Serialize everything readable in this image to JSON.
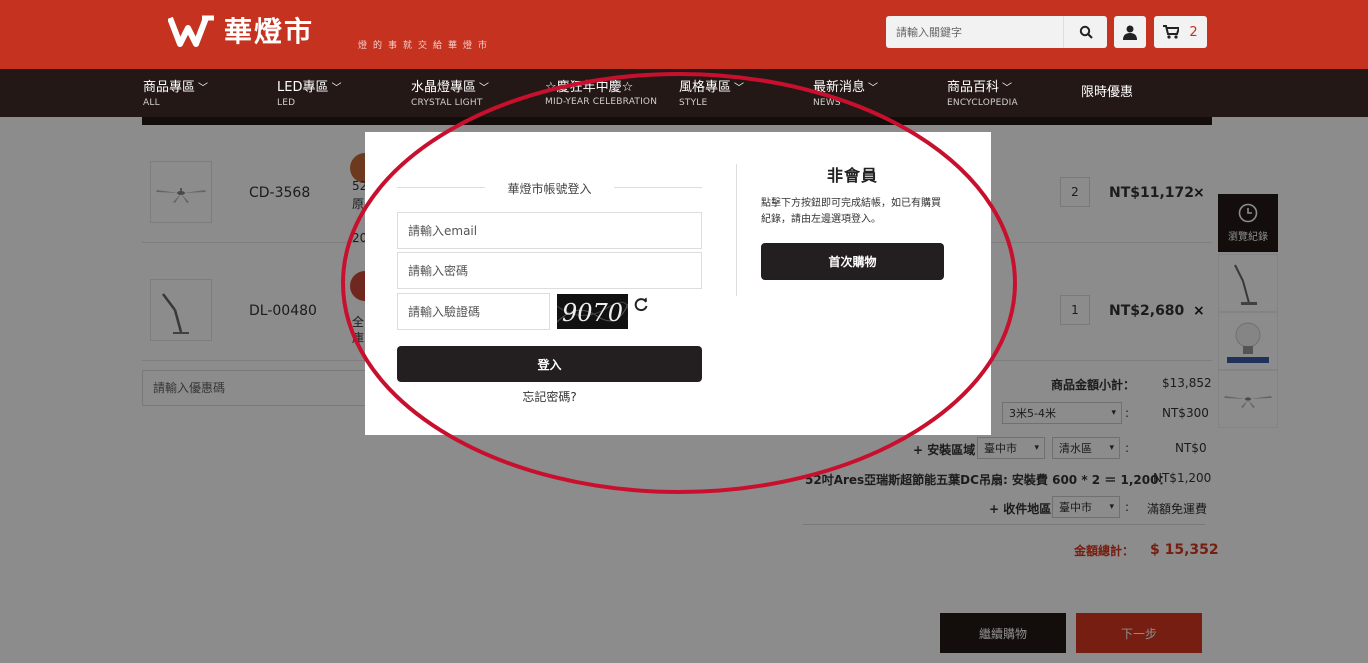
{
  "header": {
    "logo_text": "華燈市",
    "slogan": "燈的事就交給華燈市",
    "search_placeholder": "請輸入關鍵字",
    "cart_count": "2",
    "colors": {
      "brand": "#c5321f",
      "dark": "#231815"
    }
  },
  "nav": {
    "items": [
      {
        "label": "商品專區",
        "sub": "ALL"
      },
      {
        "label": "LED專區",
        "sub": "LED"
      },
      {
        "label": "水晶燈專區",
        "sub": "CRYSTAL LIGHT"
      },
      {
        "label": "☆慶狂年中慶☆",
        "sub": "MID-YEAR CELEBRATION"
      },
      {
        "label": "風格專區",
        "sub": "STYLE"
      },
      {
        "label": "最新消息",
        "sub": "NEWS"
      },
      {
        "label": "商品百科",
        "sub": "ENCYCLOPEDIA"
      },
      {
        "label": "限時優惠",
        "sub": ""
      }
    ]
  },
  "cart": {
    "rows": [
      {
        "sku": "CD-3568",
        "line1": "52",
        "line2": "原",
        "line3": "20",
        "qty": "2",
        "price": "NT$11,172"
      },
      {
        "sku": "DL-00480",
        "line1": "全",
        "line2": "庫",
        "qty": "1",
        "price": "NT$2,680"
      }
    ],
    "remove_symbol": "×",
    "coupon_placeholder": "請輸入優惠碼",
    "summary": {
      "subtotal_label": "商品金額小計：",
      "subtotal_value": "$13,852",
      "height_select": "3米5-4米",
      "height_value": "NT$300",
      "install_area_label": "+ 安裝區域",
      "install_city": "臺中市",
      "install_district": "清水區",
      "install_value": "NT$0",
      "install_fee_line": "52吋Ares亞瑞斯超節能五葉DC吊扇: 安裝費 600 * 2 ＝ 1,200：",
      "install_fee_value": "NT$1,200",
      "delivery_label": "+ 收件地區",
      "delivery_city": "臺中市",
      "delivery_value": "滿額免運費",
      "total_label": "金額總計：",
      "total_value": "$ 15,352",
      "colon": ":"
    },
    "continue_label": "繼續購物",
    "next_label": "下一步"
  },
  "history": {
    "label": "瀏覽紀錄"
  },
  "modal": {
    "login_title": "華燈市帳號登入",
    "email_placeholder": "請輸入email",
    "password_placeholder": "請輸入密碼",
    "captcha_placeholder": "請輸入驗證碼",
    "captcha_text": "9070",
    "login_button": "登入",
    "forgot_link": "忘記密碼?",
    "guest_title": "非會員",
    "guest_desc": "點擊下方按鈕即可完成結帳，如已有購買紀錄，請由左邊選項登入。",
    "guest_button": "首次購物"
  },
  "annotation": {
    "color": "#c8102e",
    "shape": "ellipse"
  }
}
